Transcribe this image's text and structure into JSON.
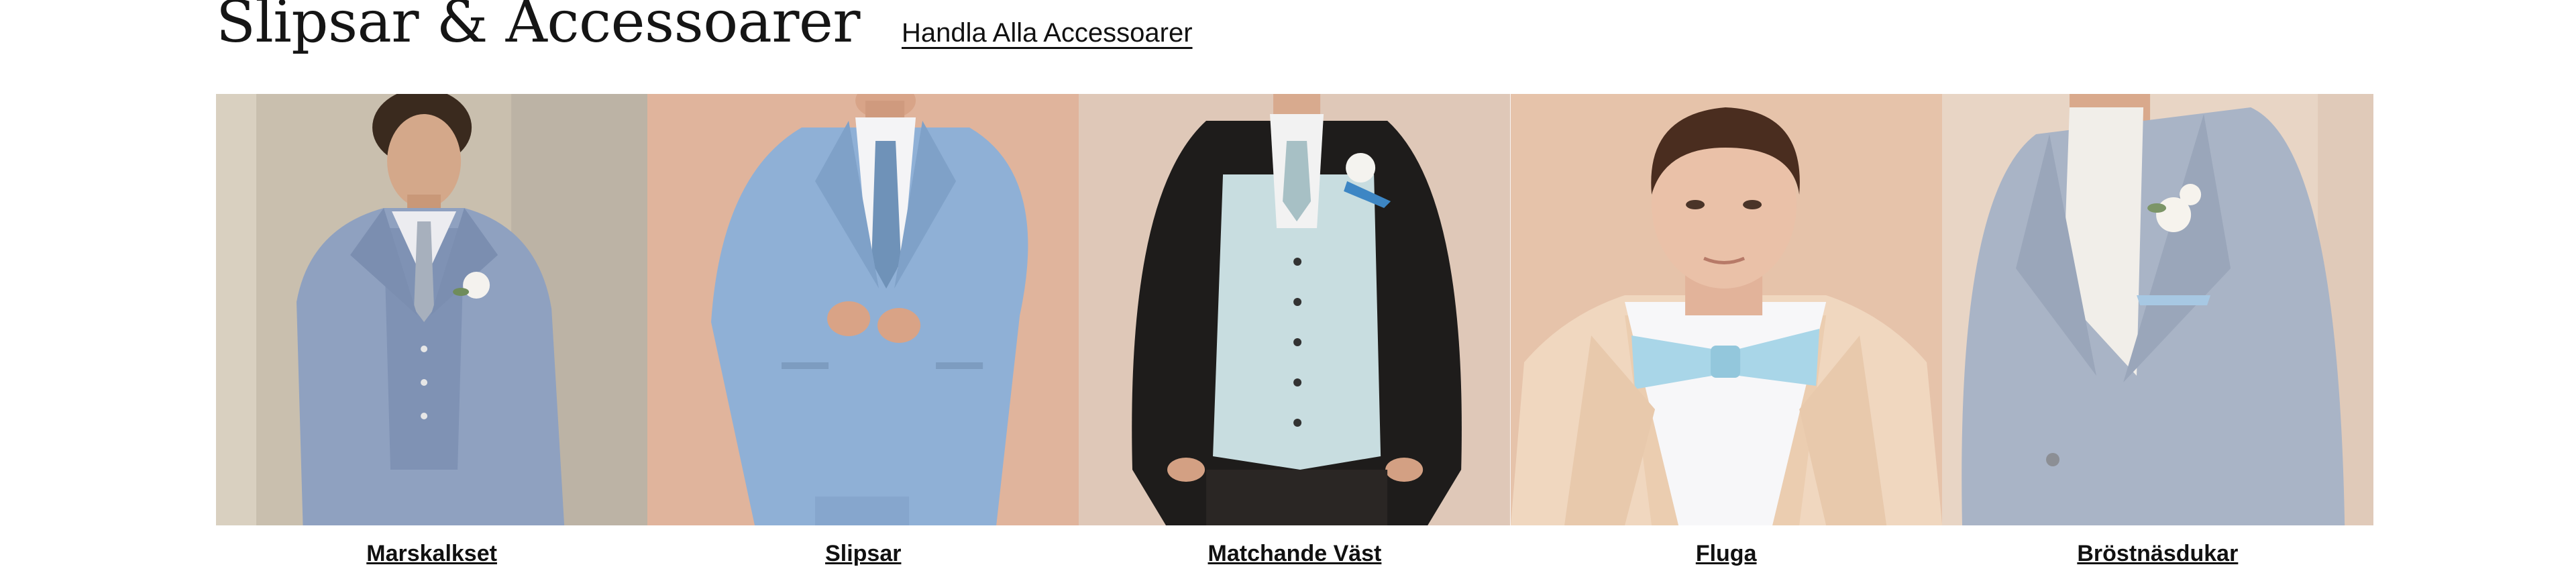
{
  "header": {
    "title": "Slipsar & Accessoarer",
    "shop_link": "Handla Alla Accessoarer"
  },
  "categories": [
    {
      "label": "Marskalkset",
      "image_icon": "man-in-blue-three-piece-suit-photo"
    },
    {
      "label": "Slipsar",
      "image_icon": "man-in-light-blue-suit-with-tie-photo"
    },
    {
      "label": "Matchande Väst",
      "image_icon": "man-in-black-jacket-with-light-blue-vest-photo"
    },
    {
      "label": "Fluga",
      "image_icon": "man-with-light-blue-bow-tie-photo"
    },
    {
      "label": "Bröstnäsdukar",
      "image_icon": "man-in-grey-suit-with-pocket-square-photo"
    }
  ]
}
